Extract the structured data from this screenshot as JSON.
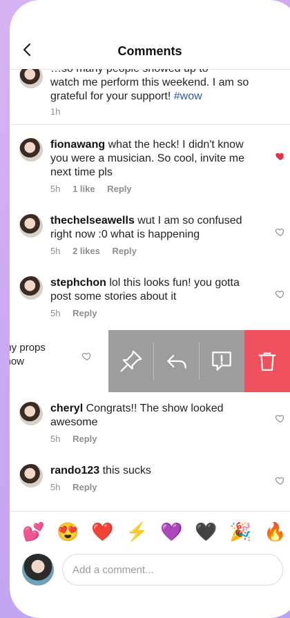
{
  "header": {
    "title": "Comments",
    "back_icon": "chevron-left-icon"
  },
  "comments": [
    {
      "username": "",
      "text_partial_top": "…so many people showed up to",
      "text": "watch me perform this weekend. I am so grateful for your support!",
      "hashtag": "#wow",
      "time": "1h"
    },
    {
      "username": "fionawang",
      "text": "what the heck! I didn't know you were a musician. So cool, invite me next time pls",
      "time": "5h",
      "likes": "1 like",
      "reply": "Reply",
      "liked": true
    },
    {
      "username": "thechelseawells",
      "text": "wut I am so confused right now :0 what is happening",
      "time": "5h",
      "likes": "2 likes",
      "reply": "Reply",
      "liked": false
    },
    {
      "username": "stephchon",
      "text": "lol this looks fun! you gotta post some stories about it",
      "time": "5h",
      "reply": "Reply",
      "liked": false
    },
    {
      "swiped_text_line1": "any props",
      "swiped_text_line2": "show",
      "actions": [
        "pin-icon",
        "reply-icon",
        "report-icon",
        "trash-icon"
      ],
      "colors": {
        "gray": "#9d9d9d",
        "delete": "#f0515f"
      }
    },
    {
      "username": "cheryl",
      "text": "Congrats!! The show looked awesome",
      "time": "5h",
      "reply": "Reply",
      "liked": false
    },
    {
      "username": "rando123",
      "text": "this sucks",
      "time": "5h",
      "reply": "Reply",
      "liked": false
    }
  ],
  "emoji_bar": [
    "💕",
    "😍",
    "❤️",
    "⚡",
    "💜",
    "🖤",
    "🎉",
    "🔥"
  ],
  "composer": {
    "placeholder": "Add a comment..."
  }
}
